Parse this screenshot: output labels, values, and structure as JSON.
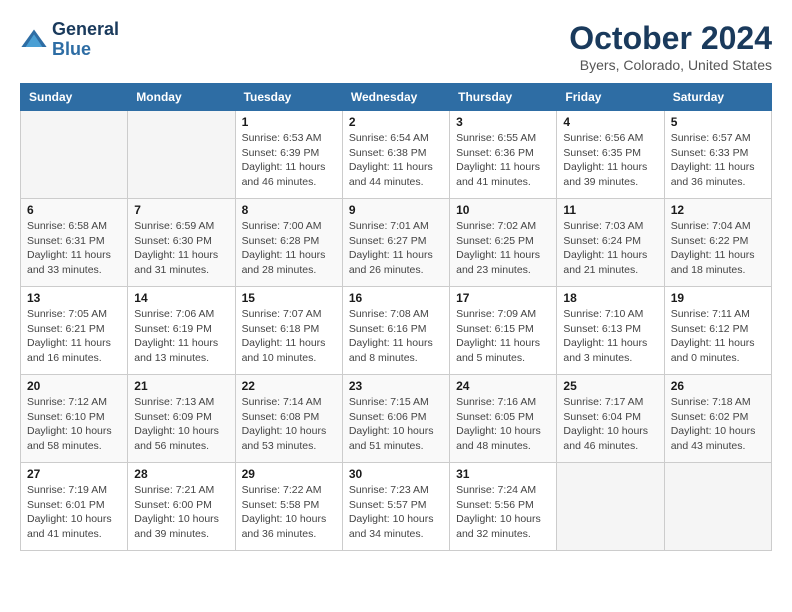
{
  "logo": {
    "line1": "General",
    "line2": "Blue"
  },
  "title": "October 2024",
  "location": "Byers, Colorado, United States",
  "days_of_week": [
    "Sunday",
    "Monday",
    "Tuesday",
    "Wednesday",
    "Thursday",
    "Friday",
    "Saturday"
  ],
  "weeks": [
    [
      {
        "day": "",
        "info": ""
      },
      {
        "day": "",
        "info": ""
      },
      {
        "day": "1",
        "info": "Sunrise: 6:53 AM\nSunset: 6:39 PM\nDaylight: 11 hours and 46 minutes."
      },
      {
        "day": "2",
        "info": "Sunrise: 6:54 AM\nSunset: 6:38 PM\nDaylight: 11 hours and 44 minutes."
      },
      {
        "day": "3",
        "info": "Sunrise: 6:55 AM\nSunset: 6:36 PM\nDaylight: 11 hours and 41 minutes."
      },
      {
        "day": "4",
        "info": "Sunrise: 6:56 AM\nSunset: 6:35 PM\nDaylight: 11 hours and 39 minutes."
      },
      {
        "day": "5",
        "info": "Sunrise: 6:57 AM\nSunset: 6:33 PM\nDaylight: 11 hours and 36 minutes."
      }
    ],
    [
      {
        "day": "6",
        "info": "Sunrise: 6:58 AM\nSunset: 6:31 PM\nDaylight: 11 hours and 33 minutes."
      },
      {
        "day": "7",
        "info": "Sunrise: 6:59 AM\nSunset: 6:30 PM\nDaylight: 11 hours and 31 minutes."
      },
      {
        "day": "8",
        "info": "Sunrise: 7:00 AM\nSunset: 6:28 PM\nDaylight: 11 hours and 28 minutes."
      },
      {
        "day": "9",
        "info": "Sunrise: 7:01 AM\nSunset: 6:27 PM\nDaylight: 11 hours and 26 minutes."
      },
      {
        "day": "10",
        "info": "Sunrise: 7:02 AM\nSunset: 6:25 PM\nDaylight: 11 hours and 23 minutes."
      },
      {
        "day": "11",
        "info": "Sunrise: 7:03 AM\nSunset: 6:24 PM\nDaylight: 11 hours and 21 minutes."
      },
      {
        "day": "12",
        "info": "Sunrise: 7:04 AM\nSunset: 6:22 PM\nDaylight: 11 hours and 18 minutes."
      }
    ],
    [
      {
        "day": "13",
        "info": "Sunrise: 7:05 AM\nSunset: 6:21 PM\nDaylight: 11 hours and 16 minutes."
      },
      {
        "day": "14",
        "info": "Sunrise: 7:06 AM\nSunset: 6:19 PM\nDaylight: 11 hours and 13 minutes."
      },
      {
        "day": "15",
        "info": "Sunrise: 7:07 AM\nSunset: 6:18 PM\nDaylight: 11 hours and 10 minutes."
      },
      {
        "day": "16",
        "info": "Sunrise: 7:08 AM\nSunset: 6:16 PM\nDaylight: 11 hours and 8 minutes."
      },
      {
        "day": "17",
        "info": "Sunrise: 7:09 AM\nSunset: 6:15 PM\nDaylight: 11 hours and 5 minutes."
      },
      {
        "day": "18",
        "info": "Sunrise: 7:10 AM\nSunset: 6:13 PM\nDaylight: 11 hours and 3 minutes."
      },
      {
        "day": "19",
        "info": "Sunrise: 7:11 AM\nSunset: 6:12 PM\nDaylight: 11 hours and 0 minutes."
      }
    ],
    [
      {
        "day": "20",
        "info": "Sunrise: 7:12 AM\nSunset: 6:10 PM\nDaylight: 10 hours and 58 minutes."
      },
      {
        "day": "21",
        "info": "Sunrise: 7:13 AM\nSunset: 6:09 PM\nDaylight: 10 hours and 56 minutes."
      },
      {
        "day": "22",
        "info": "Sunrise: 7:14 AM\nSunset: 6:08 PM\nDaylight: 10 hours and 53 minutes."
      },
      {
        "day": "23",
        "info": "Sunrise: 7:15 AM\nSunset: 6:06 PM\nDaylight: 10 hours and 51 minutes."
      },
      {
        "day": "24",
        "info": "Sunrise: 7:16 AM\nSunset: 6:05 PM\nDaylight: 10 hours and 48 minutes."
      },
      {
        "day": "25",
        "info": "Sunrise: 7:17 AM\nSunset: 6:04 PM\nDaylight: 10 hours and 46 minutes."
      },
      {
        "day": "26",
        "info": "Sunrise: 7:18 AM\nSunset: 6:02 PM\nDaylight: 10 hours and 43 minutes."
      }
    ],
    [
      {
        "day": "27",
        "info": "Sunrise: 7:19 AM\nSunset: 6:01 PM\nDaylight: 10 hours and 41 minutes."
      },
      {
        "day": "28",
        "info": "Sunrise: 7:21 AM\nSunset: 6:00 PM\nDaylight: 10 hours and 39 minutes."
      },
      {
        "day": "29",
        "info": "Sunrise: 7:22 AM\nSunset: 5:58 PM\nDaylight: 10 hours and 36 minutes."
      },
      {
        "day": "30",
        "info": "Sunrise: 7:23 AM\nSunset: 5:57 PM\nDaylight: 10 hours and 34 minutes."
      },
      {
        "day": "31",
        "info": "Sunrise: 7:24 AM\nSunset: 5:56 PM\nDaylight: 10 hours and 32 minutes."
      },
      {
        "day": "",
        "info": ""
      },
      {
        "day": "",
        "info": ""
      }
    ]
  ]
}
